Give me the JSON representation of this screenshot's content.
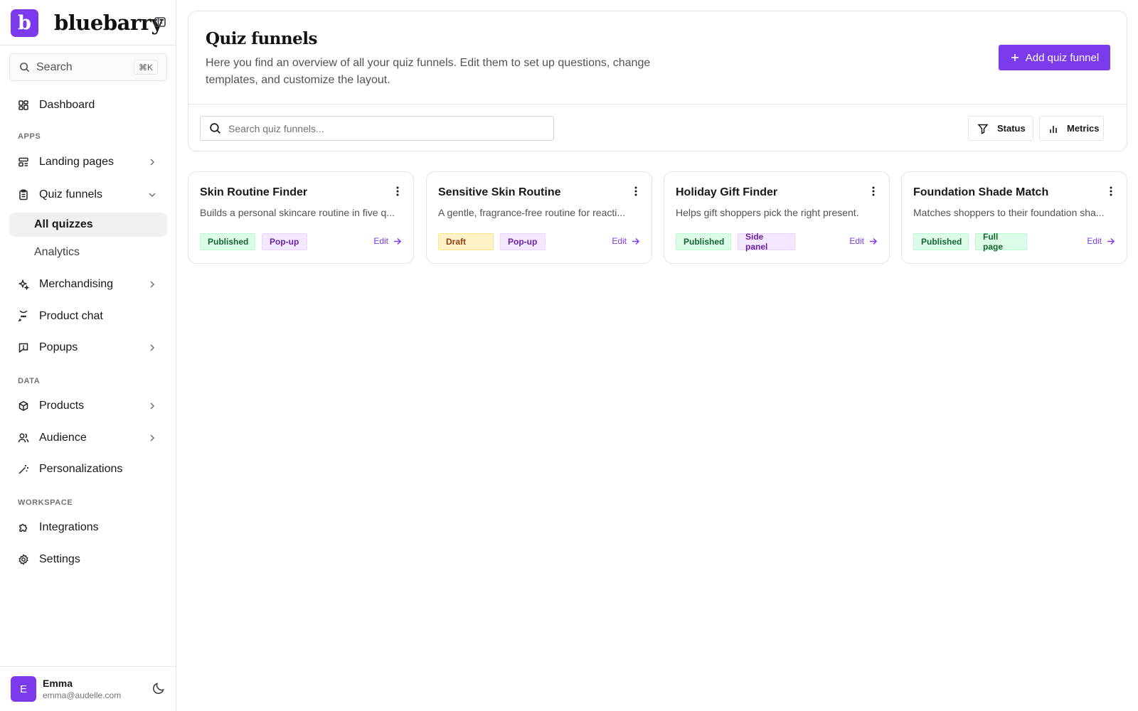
{
  "brand": {
    "logo_letter": "b",
    "name": "bluebarry"
  },
  "sidebar": {
    "search_label": "Search",
    "search_shortcut": "⌘K",
    "dashboard": "Dashboard",
    "sections": {
      "apps": "APPS",
      "data": "DATA",
      "workspace": "WORKSPACE"
    },
    "items": {
      "landing_pages": "Landing pages",
      "quiz_funnels": "Quiz funnels",
      "all_quizzes": "All quizzes",
      "analytics": "Analytics",
      "merchandising": "Merchandising",
      "product_chat": "Product chat",
      "popups": "Popups",
      "products": "Products",
      "audience": "Audience",
      "personalizations": "Personalizations",
      "integrations": "Integrations",
      "settings": "Settings"
    },
    "user": {
      "initial": "E",
      "name": "Emma",
      "email": "emma@audelle.com"
    }
  },
  "header": {
    "title": "Quiz funnels",
    "description": "Here you find an overview of all your quiz funnels. Edit them to set up questions, change templates, and customize the layout.",
    "add_button": "Add quiz funnel",
    "search_placeholder": "Search quiz funnels...",
    "status_filter": "Status",
    "metrics_filter": "Metrics"
  },
  "quizzes": [
    {
      "title": "Skin Routine Finder",
      "description": "Builds a personal skincare routine in five q...",
      "status": "Published",
      "type": "Pop-up",
      "edit": "Edit"
    },
    {
      "title": "Sensitive Skin Routine",
      "description": "A gentle, fragrance-free routine for reacti...",
      "status": "Draft",
      "type": "Pop-up",
      "edit": "Edit"
    },
    {
      "title": "Holiday Gift Finder",
      "description": "Helps gift shoppers pick the right present.",
      "status": "Published",
      "type": "Side panel",
      "edit": "Edit"
    },
    {
      "title": "Foundation Shade Match",
      "description": "Matches shoppers to their foundation sha...",
      "status": "Published",
      "type": "Full page",
      "edit": "Edit"
    }
  ],
  "colors": {
    "accent": "#7c3aed",
    "border": "#e4e4e7",
    "published_bg": "#dcfce7",
    "draft_bg": "#fef3c7",
    "type_bg": "#f3e8ff"
  }
}
